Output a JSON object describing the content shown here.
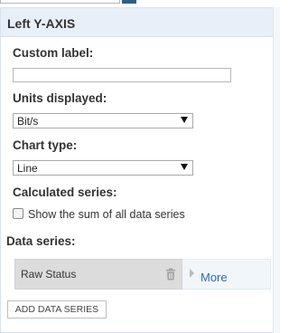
{
  "panel": {
    "title": "Left Y-AXIS"
  },
  "custom_label": {
    "label": "Custom label:",
    "value": ""
  },
  "units": {
    "label": "Units displayed:",
    "selected": "Bit/s"
  },
  "chart_type": {
    "label": "Chart type:",
    "selected": "Line"
  },
  "calculated_series": {
    "label": "Calculated series:",
    "checkbox_label": "Show the sum of all data series",
    "checked": false
  },
  "data_series": {
    "label": "Data series:",
    "items": [
      {
        "name": "Raw Status"
      }
    ],
    "more_label": "More",
    "add_label": "ADD DATA SERIES"
  },
  "icons": {
    "trash": "trash-icon",
    "dropdown": "chevron-down-icon",
    "expand": "chevron-right-icon"
  }
}
